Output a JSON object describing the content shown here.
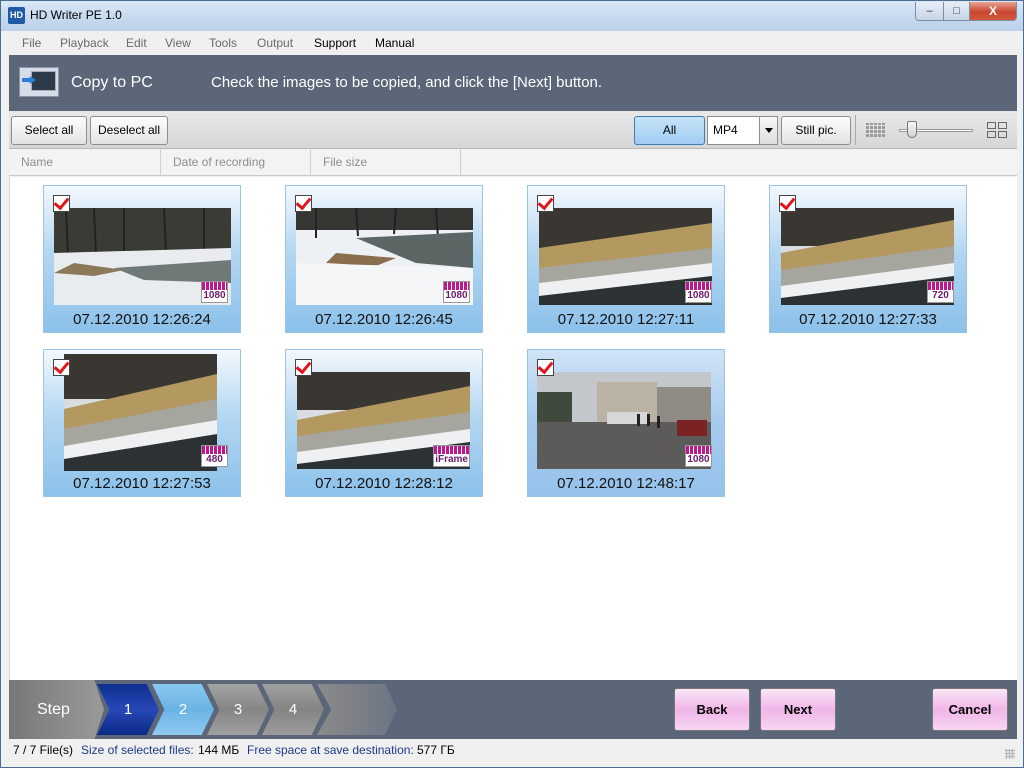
{
  "window": {
    "title": "HD Writer PE 1.0",
    "icon": "HD",
    "controls": {
      "minimize": "–",
      "maximize": "□",
      "close": "X"
    }
  },
  "menu": {
    "items": [
      {
        "label": "File",
        "active": false
      },
      {
        "label": "Playback",
        "active": false
      },
      {
        "label": "Edit",
        "active": false
      },
      {
        "label": "View",
        "active": false
      },
      {
        "label": "Tools",
        "active": false
      },
      {
        "label": "Output",
        "active": false
      },
      {
        "label": "Support",
        "active": true
      },
      {
        "label": "Manual",
        "active": true
      }
    ]
  },
  "header": {
    "title": "Copy to PC",
    "hint": "Check the images to be copied, and click the [Next] button."
  },
  "toolbar": {
    "select_all": "Select all",
    "deselect_all": "Deselect all",
    "filter_all": "All",
    "format_value": "MP4",
    "still_pic": "Still pic.",
    "zoom_level": 0.15
  },
  "columns": [
    "Name",
    "Date of recording",
    "File size"
  ],
  "thumbnails": [
    {
      "date": "07.12.2010 12:26:24",
      "badge": "1080",
      "checked": true,
      "scene": "river-snow"
    },
    {
      "date": "07.12.2010 12:26:45",
      "badge": "1080",
      "checked": true,
      "scene": "snow-bank"
    },
    {
      "date": "07.12.2010 12:27:11",
      "badge": "1080",
      "checked": true,
      "scene": "wall"
    },
    {
      "date": "07.12.2010 12:27:33",
      "badge": "720",
      "checked": true,
      "scene": "wall"
    },
    {
      "date": "07.12.2010 12:27:53",
      "badge": "480",
      "checked": true,
      "scene": "wall"
    },
    {
      "date": "07.12.2010 12:28:12",
      "badge": "iFrame",
      "checked": true,
      "scene": "wall"
    },
    {
      "date": "07.12.2010 12:48:17",
      "badge": "1080",
      "checked": true,
      "scene": "street"
    }
  ],
  "steps": {
    "label": "Step",
    "items": [
      "1",
      "2",
      "3",
      "4"
    ],
    "current": 2
  },
  "nav": {
    "back": "Back",
    "next": "Next",
    "cancel": "Cancel"
  },
  "status": {
    "files": "7 / 7 File(s)",
    "size_label": "Size of selected files:",
    "size_value": "144 МБ",
    "free_label": "Free space at save destination:",
    "free_value": "577 ГБ"
  }
}
